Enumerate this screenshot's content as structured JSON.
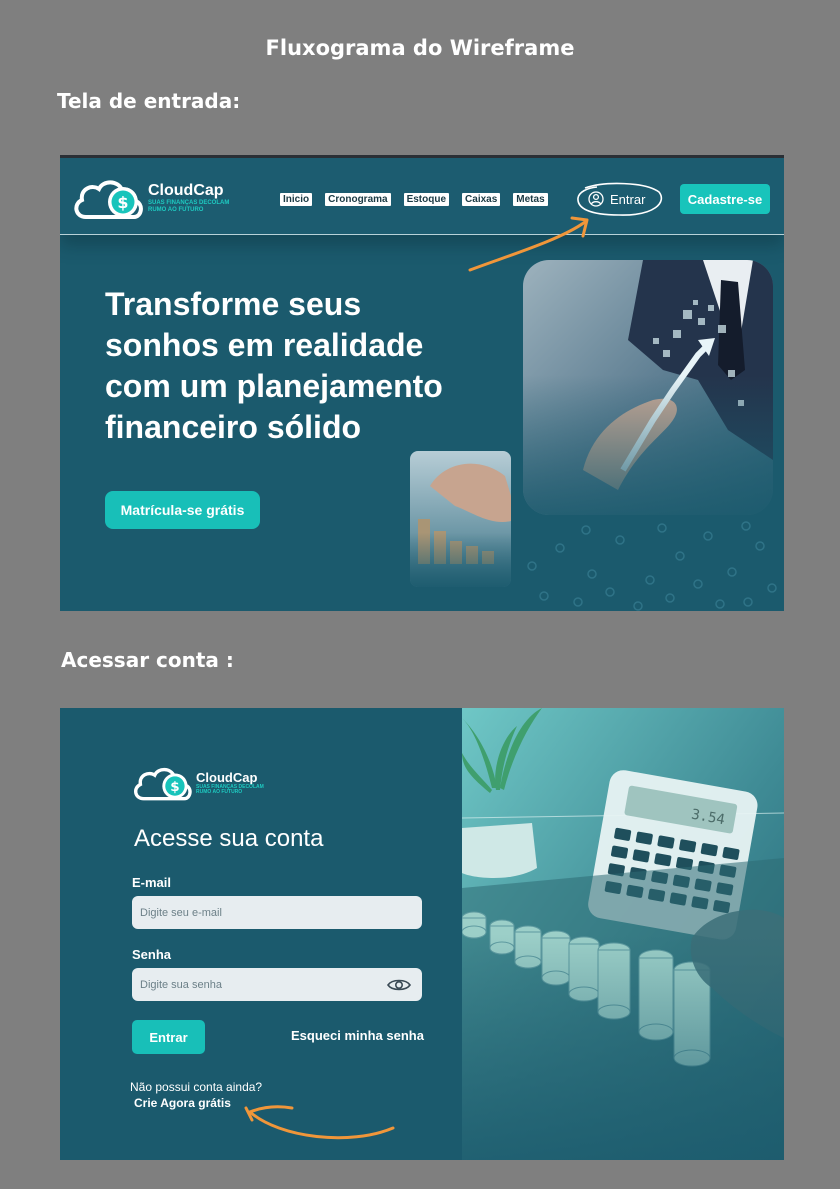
{
  "document": {
    "title": "Fluxograma do Wireframe",
    "section1_title": "Tela de entrada:",
    "section2_title": "Acessar conta :"
  },
  "landing": {
    "logo": {
      "brand": "CloudCap",
      "tagline_line1": "SUAS FINANÇAS DECOLAM",
      "tagline_line2": "RUMO AO FUTURO"
    },
    "nav": [
      {
        "label": "Inicio"
      },
      {
        "label": "Cronograma"
      },
      {
        "label": "Estoque"
      },
      {
        "label": "Caixas"
      },
      {
        "label": "Metas"
      }
    ],
    "login_link": "Entrar",
    "signup_button": "Cadastre-se",
    "hero_line1": "Transforme seus",
    "hero_line2": "sonhos em realidade",
    "hero_line3": "com um planejamento",
    "hero_line4": "financeiro sólido",
    "cta_button": "Matrícula-se grátis"
  },
  "login": {
    "logo": {
      "brand": "CloudCap",
      "tagline_line1": "SUAS FINANÇAS DECOLAM",
      "tagline_line2": "RUMO AO FUTURO"
    },
    "heading": "Acesse sua conta",
    "email_label": "E-mail",
    "email_placeholder": "Digite seu e-mail",
    "password_label": "Senha",
    "password_placeholder": "Digite sua senha",
    "submit_button": "Entrar",
    "forgot_link": "Esqueci minha senha",
    "no_account_text": "Não possui conta ainda?",
    "create_link": "Crie Agora grátis"
  },
  "colors": {
    "background": "#7f7f7f",
    "panel": "#1b5a6d",
    "accent": "#18c4bb",
    "annotation_arrow": "#f0963a"
  },
  "icons": [
    "cloud-dollar-logo-icon",
    "user-circle-icon",
    "eye-icon",
    "annotation-arrow"
  ]
}
